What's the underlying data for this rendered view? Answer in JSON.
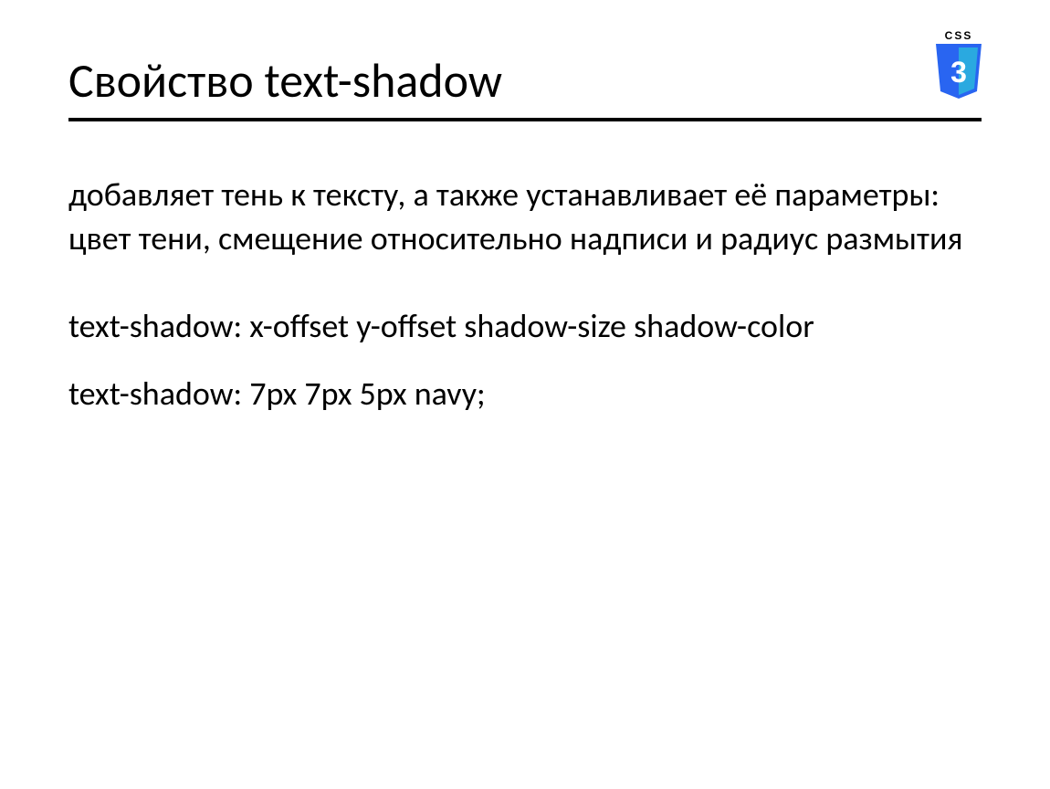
{
  "logo": {
    "label": "CSS",
    "glyph": "3"
  },
  "title": "Свойство text-shadow",
  "paragraphs": {
    "p1": "добавляет тень к тексту, а также устанавливает её параметры: цвет тени, смещение относительно надписи и радиус размытия",
    "p2": "text-shadow: x-offset y-offset shadow-size shadow-color",
    "p3": "text-shadow: 7px 7px 5px navy;"
  }
}
